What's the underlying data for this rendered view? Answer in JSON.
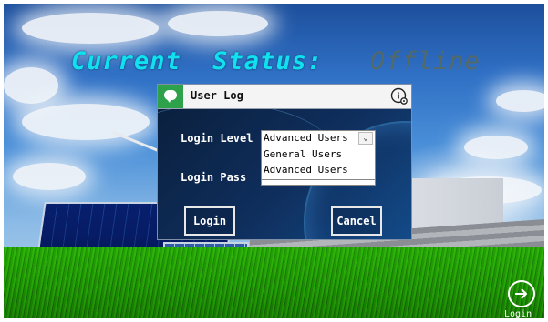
{
  "header": {
    "status_label": "Current  Status:",
    "status_value": "Offline"
  },
  "dialog": {
    "title": "User Log",
    "level_label": "Login Level",
    "pass_label": "Login Pass",
    "level_selected": "Advanced Users",
    "level_options": [
      "General Users",
      "Advanced Users"
    ],
    "login_button": "Login",
    "cancel_button": "Cancel"
  },
  "corner": {
    "login_label": "Login"
  },
  "icons": {
    "title": "chat-bubble-icon",
    "settings": "gear-settings-icon",
    "corner": "arrow-right-circle-icon",
    "dropdown": "chevron-down-icon"
  }
}
